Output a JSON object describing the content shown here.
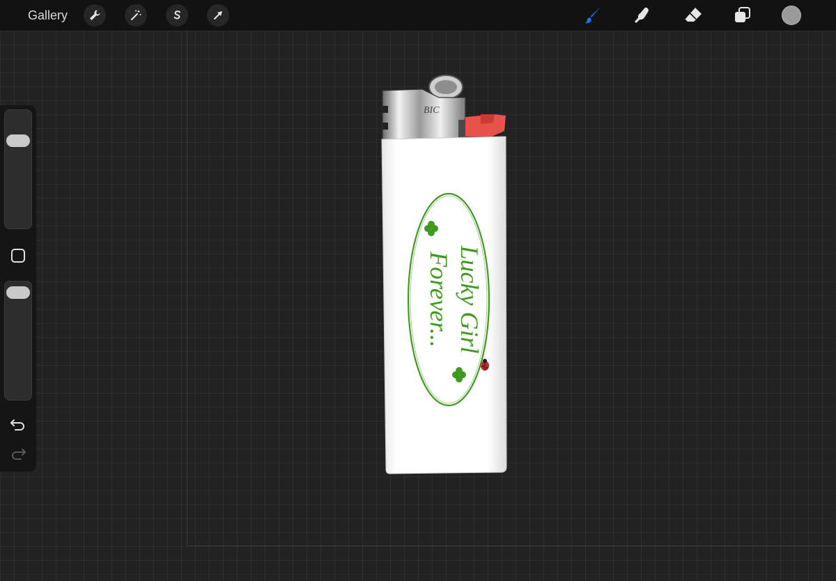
{
  "topbar": {
    "gallery_label": "Gallery",
    "left_tools": [
      {
        "name": "actions",
        "icon": "wrench-icon"
      },
      {
        "name": "adjustments",
        "icon": "magic-wand-icon"
      },
      {
        "name": "selection",
        "icon": "selection-s-icon"
      },
      {
        "name": "transform",
        "icon": "arrow-cursor-icon"
      }
    ],
    "right_tools": [
      {
        "name": "brush",
        "icon": "brush-icon",
        "active": true
      },
      {
        "name": "smudge",
        "icon": "smudge-finger-icon",
        "active": false
      },
      {
        "name": "eraser",
        "icon": "eraser-icon",
        "active": false
      },
      {
        "name": "layers",
        "icon": "layers-icon",
        "active": false
      }
    ],
    "current_color": "#9a9a9a"
  },
  "sidebar": {
    "brush_size_level": 0.78,
    "opacity_level": 0.97,
    "modify_icon": "square-modify-icon",
    "undo_icon": "undo-icon",
    "redo_icon": "redo-icon",
    "redo_enabled": false
  },
  "colors": {
    "accent": "#1a73e8",
    "toolbar_bg": "#121212",
    "canvas_bg": "#222222",
    "print_green": "#3f9a1f",
    "lighter_red": "#e8524a",
    "lighter_body": "#ffffff"
  },
  "artwork": {
    "subject": "white lighter",
    "cap_text": "BIC",
    "print_line1": "Lucky Girl",
    "print_line2": "Forever..."
  }
}
